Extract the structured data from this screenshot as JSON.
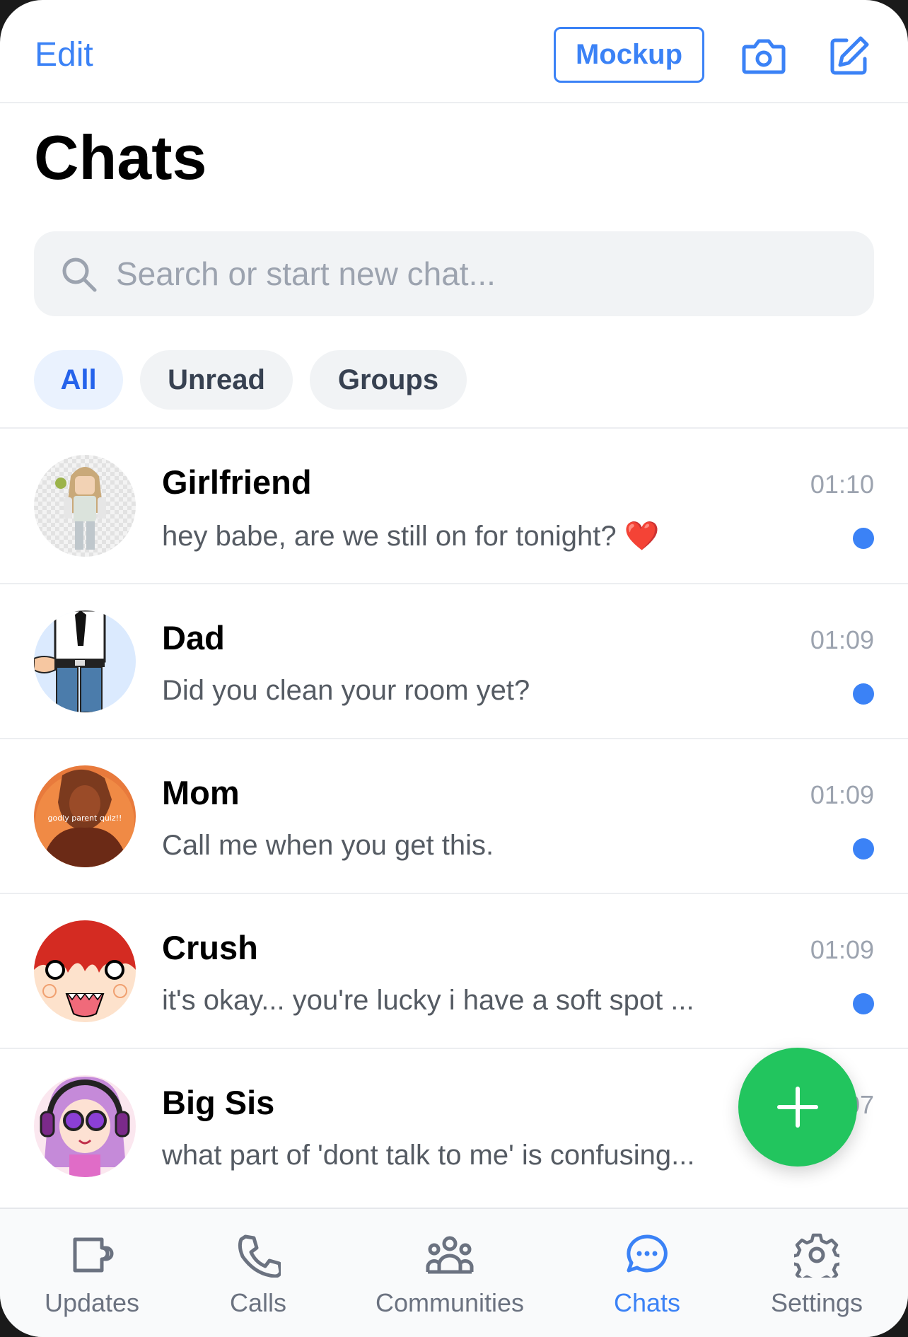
{
  "header": {
    "edit_label": "Edit",
    "mockup_label": "Mockup",
    "title": "Chats"
  },
  "search": {
    "placeholder": "Search or start new chat..."
  },
  "filters": [
    {
      "label": "All",
      "active": true
    },
    {
      "label": "Unread",
      "active": false
    },
    {
      "label": "Groups",
      "active": false
    }
  ],
  "chats": [
    {
      "name": "Girlfriend",
      "time": "01:10",
      "preview": "hey babe, are we still on for tonight? ❤️",
      "unread": true
    },
    {
      "name": "Dad",
      "time": "01:09",
      "preview": "Did you clean your room yet?",
      "unread": true
    },
    {
      "name": "Mom",
      "time": "01:09",
      "preview": "Call me when you get this.",
      "unread": true,
      "avatar_text": "godly parent quiz!!"
    },
    {
      "name": "Crush",
      "time": "01:09",
      "preview": "it's okay... you're lucky i have a soft spot ...",
      "unread": true
    },
    {
      "name": "Big Sis",
      "time": "01:07",
      "preview": "what part of 'dont talk to me' is confusing...",
      "unread": false
    }
  ],
  "nav": [
    {
      "label": "Updates",
      "icon": "updates-icon",
      "active": false
    },
    {
      "label": "Calls",
      "icon": "phone-icon",
      "active": false
    },
    {
      "label": "Communities",
      "icon": "communities-icon",
      "active": false
    },
    {
      "label": "Chats",
      "icon": "chat-bubble-icon",
      "active": true
    },
    {
      "label": "Settings",
      "icon": "gear-icon",
      "active": false
    }
  ],
  "colors": {
    "accent": "#3b82f6",
    "fab": "#22c55e",
    "unread_dot": "#3b82f6"
  }
}
